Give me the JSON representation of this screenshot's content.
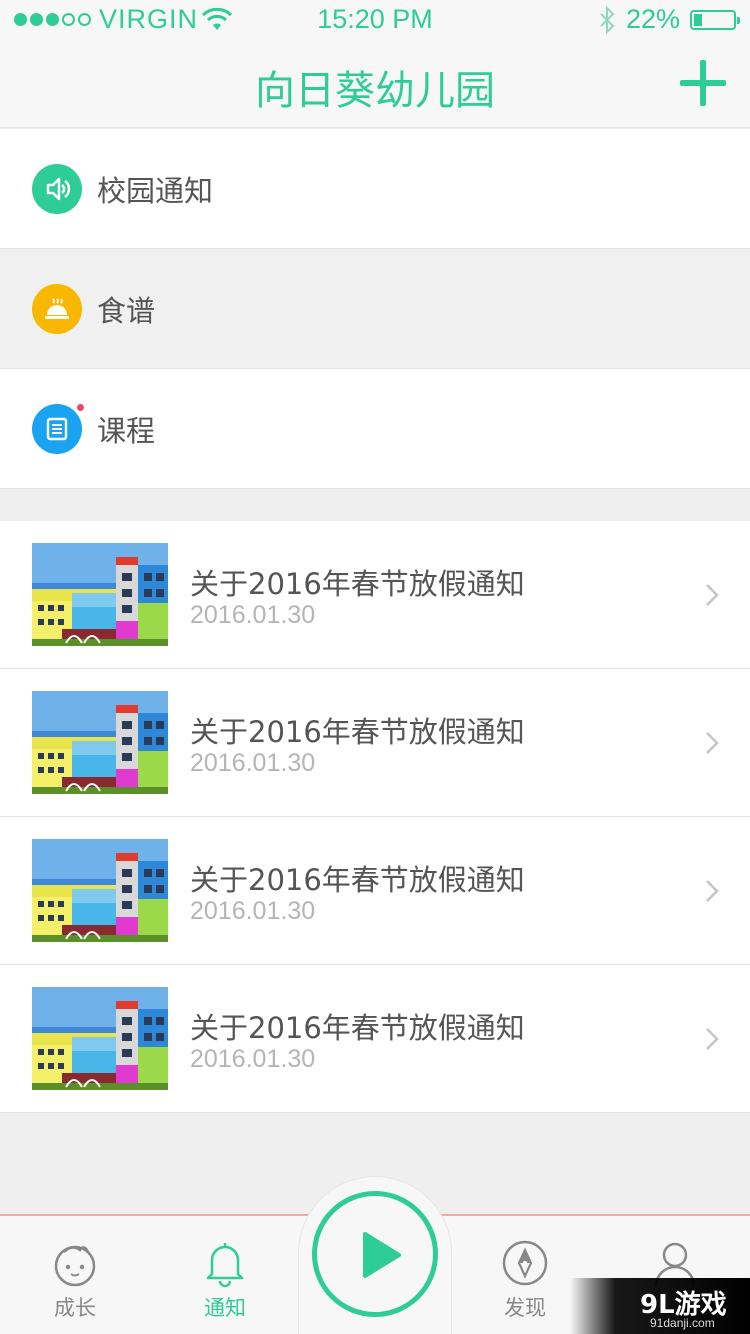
{
  "status_bar": {
    "carrier": "VIRGIN",
    "time": "15:20 PM",
    "battery": "22%",
    "battery_level": 0.22,
    "signal_dots_filled": 3,
    "signal_dots_total": 5
  },
  "header": {
    "title": "向日葵幼儿园",
    "add_icon": "plus-icon"
  },
  "menu": [
    {
      "label": "校园通知",
      "icon": "speaker-icon",
      "color": "#2ecc96"
    },
    {
      "label": "食谱",
      "icon": "dish-icon",
      "color": "#f9b800"
    },
    {
      "label": "课程",
      "icon": "document-icon",
      "color": "#1aa3f0",
      "has_badge": true
    }
  ],
  "news": [
    {
      "title": "关于2016年春节放假通知",
      "date": "2016.01.30"
    },
    {
      "title": "关于2016年春节放假通知",
      "date": "2016.01.30"
    },
    {
      "title": "关于2016年春节放假通知",
      "date": "2016.01.30"
    },
    {
      "title": "关于2016年春节放假通知",
      "date": "2016.01.30"
    }
  ],
  "tabs": [
    {
      "label": "成长",
      "icon": "baby-face-icon",
      "active": false
    },
    {
      "label": "通知",
      "icon": "bell-icon",
      "active": true
    },
    {
      "label": "",
      "icon": "play-icon",
      "active": false
    },
    {
      "label": "发现",
      "icon": "compass-icon",
      "active": false
    },
    {
      "label": "",
      "icon": "person-icon",
      "active": false
    }
  ],
  "watermark": {
    "main": "9L游戏",
    "sub": "91danji.com"
  },
  "colors": {
    "accent": "#2ecc96",
    "badge": "#f2416c"
  }
}
